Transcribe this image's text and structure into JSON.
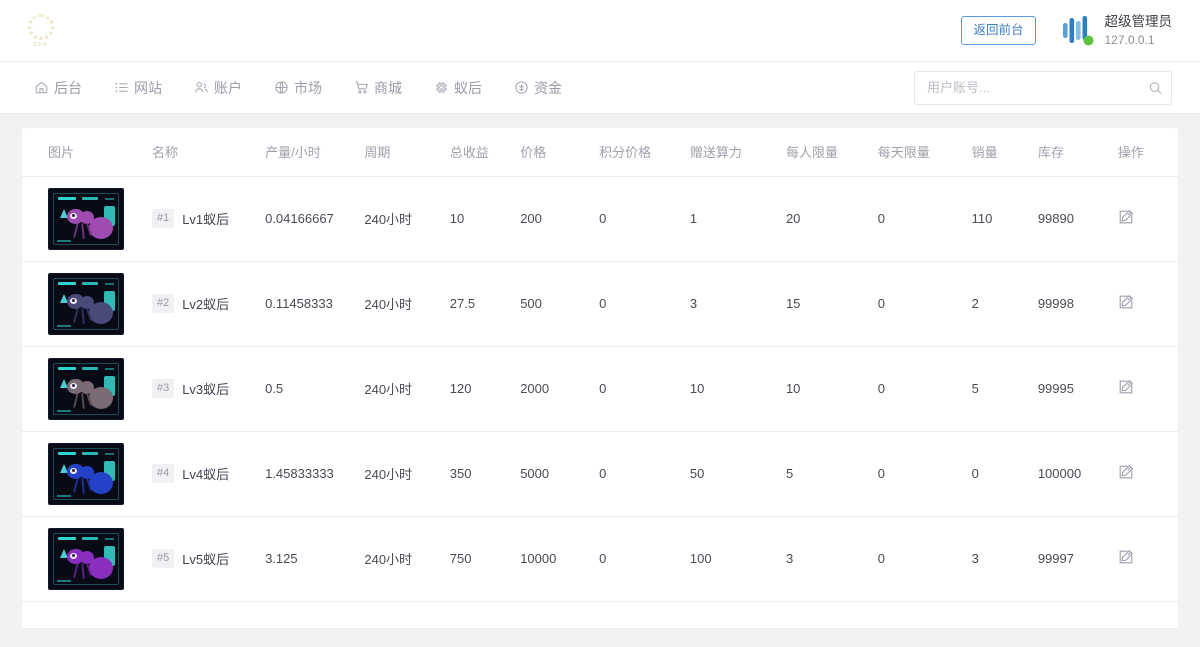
{
  "header": {
    "logo_text": "ZEN",
    "back_button": "返回前台",
    "user_name": "超级管理员",
    "user_ip": "127.0.0.1"
  },
  "nav": {
    "items": [
      {
        "label": "后台",
        "icon": "home-icon"
      },
      {
        "label": "网站",
        "icon": "list-icon"
      },
      {
        "label": "账户",
        "icon": "users-icon"
      },
      {
        "label": "市场",
        "icon": "globe-icon"
      },
      {
        "label": "商城",
        "icon": "cart-icon"
      },
      {
        "label": "蚁后",
        "icon": "chip-icon"
      },
      {
        "label": "资金",
        "icon": "coin-icon"
      }
    ]
  },
  "search": {
    "placeholder": "用户账号...",
    "value": ""
  },
  "table": {
    "headers": [
      "图片",
      "名称",
      "产量/小时",
      "周期",
      "总收益",
      "价格",
      "积分价格",
      "赠送算力",
      "每人限量",
      "每天限量",
      "销量",
      "库存",
      "操作"
    ],
    "rows": [
      {
        "rank": "#1",
        "name": "Lv1蚁后",
        "rate": "0.04166667",
        "cycle": "240小时",
        "total_income": "10",
        "price": "200",
        "points_price": "0",
        "gift_power": "1",
        "per_person_limit": "20",
        "per_day_limit": "0",
        "sales": "110",
        "stock": "99890",
        "ant_color": "#a04bb0",
        "ant_dark": "#6d2e7c"
      },
      {
        "rank": "#2",
        "name": "Lv2蚁后",
        "rate": "0.11458333",
        "cycle": "240小时",
        "total_income": "27.5",
        "price": "500",
        "points_price": "0",
        "gift_power": "3",
        "per_person_limit": "15",
        "per_day_limit": "0",
        "sales": "2",
        "stock": "99998",
        "ant_color": "#4a4a7a",
        "ant_dark": "#30305a"
      },
      {
        "rank": "#3",
        "name": "Lv3蚁后",
        "rate": "0.5",
        "cycle": "240小时",
        "total_income": "120",
        "price": "2000",
        "points_price": "0",
        "gift_power": "10",
        "per_person_limit": "10",
        "per_day_limit": "0",
        "sales": "5",
        "stock": "99995",
        "ant_color": "#7a6a74",
        "ant_dark": "#554951"
      },
      {
        "rank": "#4",
        "name": "Lv4蚁后",
        "rate": "1.45833333",
        "cycle": "240小时",
        "total_income": "350",
        "price": "5000",
        "points_price": "0",
        "gift_power": "50",
        "per_person_limit": "5",
        "per_day_limit": "0",
        "sales": "0",
        "stock": "100000",
        "ant_color": "#2442c8",
        "ant_dark": "#1a2f91"
      },
      {
        "rank": "#5",
        "name": "Lv5蚁后",
        "rate": "3.125",
        "cycle": "240小时",
        "total_income": "750",
        "price": "10000",
        "points_price": "0",
        "gift_power": "100",
        "per_person_limit": "3",
        "per_day_limit": "0",
        "sales": "3",
        "stock": "99997",
        "ant_color": "#8a2ec0",
        "ant_dark": "#5d1f85"
      }
    ]
  },
  "colors": {
    "accent": "#3d7fc4",
    "page_bg": "#f2f2f4",
    "card_bg": "#ffffff"
  }
}
